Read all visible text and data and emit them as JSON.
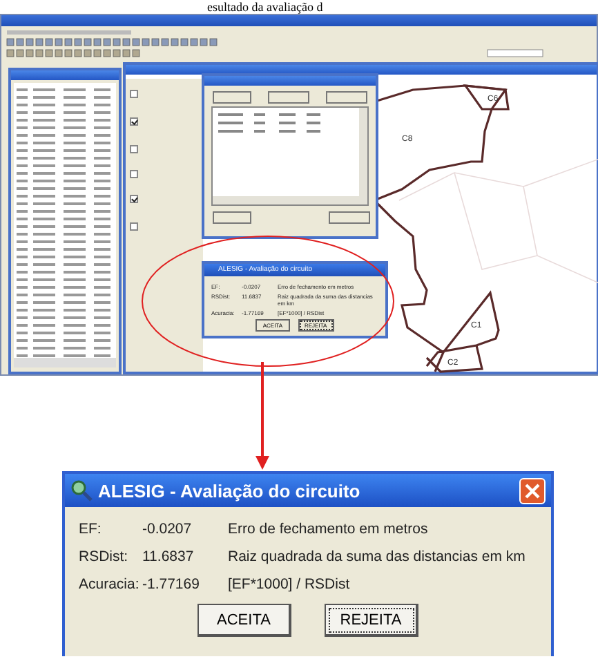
{
  "caption": "esultado da avaliação d",
  "map_labels": [
    {
      "text": "C6",
      "kind": "top"
    },
    {
      "text": "C8",
      "kind": "left"
    },
    {
      "text": "C1",
      "kind": "right"
    },
    {
      "text": "C2",
      "kind": "bottom"
    }
  ],
  "legend": [
    {
      "checked": false
    },
    {
      "checked": true
    },
    {
      "checked": false
    },
    {
      "checked": false
    },
    {
      "checked": true
    },
    {
      "checked": false
    }
  ],
  "small_dialog": {
    "title": "ALESIG - Avaliação do circuito",
    "rows": [
      {
        "label": "EF:",
        "value": "-0.0207",
        "description": "Erro de fechamento em metros"
      },
      {
        "label": "RSDist:",
        "value": "11.6837",
        "description": "Raiz quadrada da suma das distancias em km"
      },
      {
        "label": "Acuracia:",
        "value": "-1.77169",
        "description": "[EF*1000] / RSDist"
      }
    ],
    "buttons": [
      {
        "label": "ACEITA",
        "selected": false
      },
      {
        "label": "REJEITA",
        "selected": true
      }
    ]
  },
  "dialog": {
    "title": "ALESIG - Avaliação do circuito",
    "rows": [
      {
        "label": "EF:",
        "value": "-0.0207",
        "description": "Erro de fechamento em metros"
      },
      {
        "label": "RSDist:",
        "value": "11.6837",
        "description": "Raiz quadrada da suma das distancias em km"
      },
      {
        "label": "Acuracia:",
        "value": "-1.77169",
        "description": "[EF*1000] / RSDist"
      }
    ],
    "buttons": [
      {
        "label": "ACEITA",
        "selected": false
      },
      {
        "label": "REJEITA",
        "selected": true
      }
    ]
  }
}
